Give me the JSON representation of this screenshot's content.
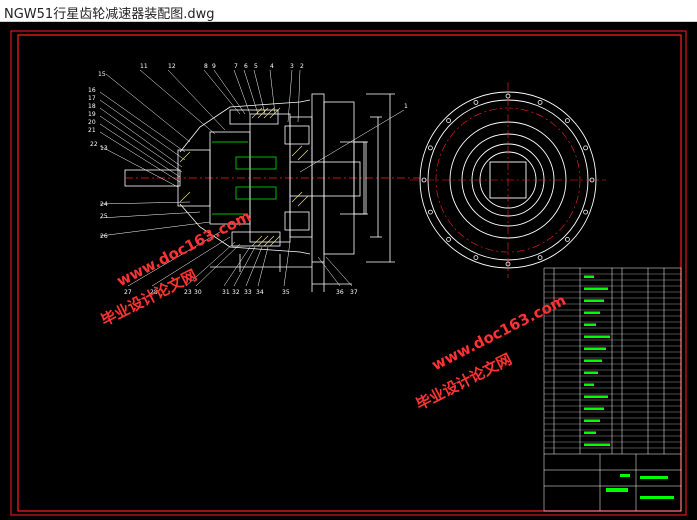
{
  "window": {
    "title": "NGW51行星齿轮减速器装配图.dwg"
  },
  "drawing": {
    "background_color": "#000000",
    "frame_color": "#ff2020",
    "line_color": "#ffffff",
    "accent_color": "#00ff00",
    "hatch_color": "#ffff00",
    "watermark_color": "#ff3333",
    "watermarks": [
      {
        "line1": "毕业设计论文网",
        "line2": "www.doc163.com"
      },
      {
        "line1": "毕业设计论文网",
        "line2": "www.doc163.com"
      }
    ],
    "part_balloons_left": [
      "15",
      "16",
      "17",
      "18",
      "19",
      "20",
      "21",
      "22",
      "23",
      "13",
      "24",
      "25",
      "26",
      "27",
      "28"
    ],
    "part_balloons_top": [
      "11",
      "12",
      "8",
      "9",
      "10",
      "7",
      "6",
      "5",
      "4",
      "3",
      "2"
    ],
    "part_balloons_bottom": [
      "29",
      "30",
      "31",
      "32",
      "33",
      "34",
      "35",
      "36",
      "37"
    ],
    "leader_right": "1"
  }
}
